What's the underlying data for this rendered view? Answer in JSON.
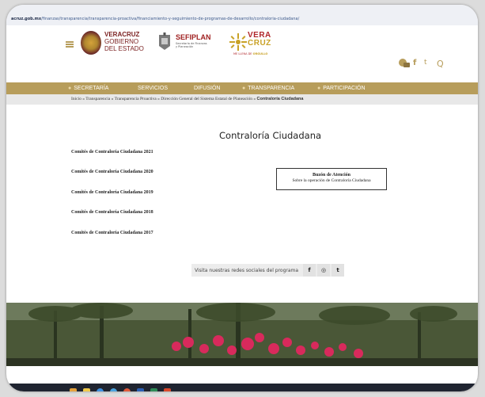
{
  "browser": {
    "url_prefix": "acruz.gob.mx",
    "url_path": "/finanzas/transparencia/transparencia-proactiva/financiamiento-y-seguimiento-de-programas-de-desarrollo/contraloria-ciudadana/"
  },
  "header": {
    "veracruz_lines": [
      "VERACRUZ",
      "GOBIERNO",
      "DEL ESTADO"
    ],
    "sefiplan_name": "SEFIPLAN",
    "sefiplan_sub": "Secretaría de Finanzas y Planeación",
    "vc_lines": [
      "VERA",
      "CRUZ"
    ],
    "vc_slogan_prefix": "ME LLENA DE",
    "vc_slogan_highlight": "ORGULLO",
    "icons": [
      "chat-icon",
      "facebook-icon",
      "twitter-icon",
      "search-icon"
    ],
    "icon_glyphs": {
      "facebook": "f",
      "twitter": "t",
      "search": "Q"
    }
  },
  "nav": {
    "items": [
      "SECRETARÍA",
      "SERVICIOS",
      "DIFUSIÓN",
      "TRANSPARENCIA",
      "PARTICIPACIÓN"
    ]
  },
  "breadcrumb": {
    "items": [
      "Inicio",
      "Transparencia",
      "Transparencia Proactiva",
      "Dirección General del Sistema Estatal de Planeación"
    ],
    "separator": "»",
    "current": "Contraloría Ciudadana"
  },
  "main": {
    "title": "Contraloría Ciudadana",
    "links": [
      "Comités de Contraloría Ciudadana 2021",
      "Comités de Contraloría Ciudadana 2020",
      "Comités de Contraloría Ciudadana 2019",
      "Comités de Contraloría Ciudadana 2018",
      "Comités de Contraloría Ciudadana 2017"
    ],
    "buzon_title": "Buzón de Atención",
    "buzon_subtitle": "Sobre la operación de Contraloría Ciudadana"
  },
  "social": {
    "label": "Visita nuestras redes sociales del programa",
    "buttons": [
      "f",
      "◎",
      "t"
    ]
  },
  "colors": {
    "nav": "#b79d5b",
    "accent": "#a02222"
  }
}
